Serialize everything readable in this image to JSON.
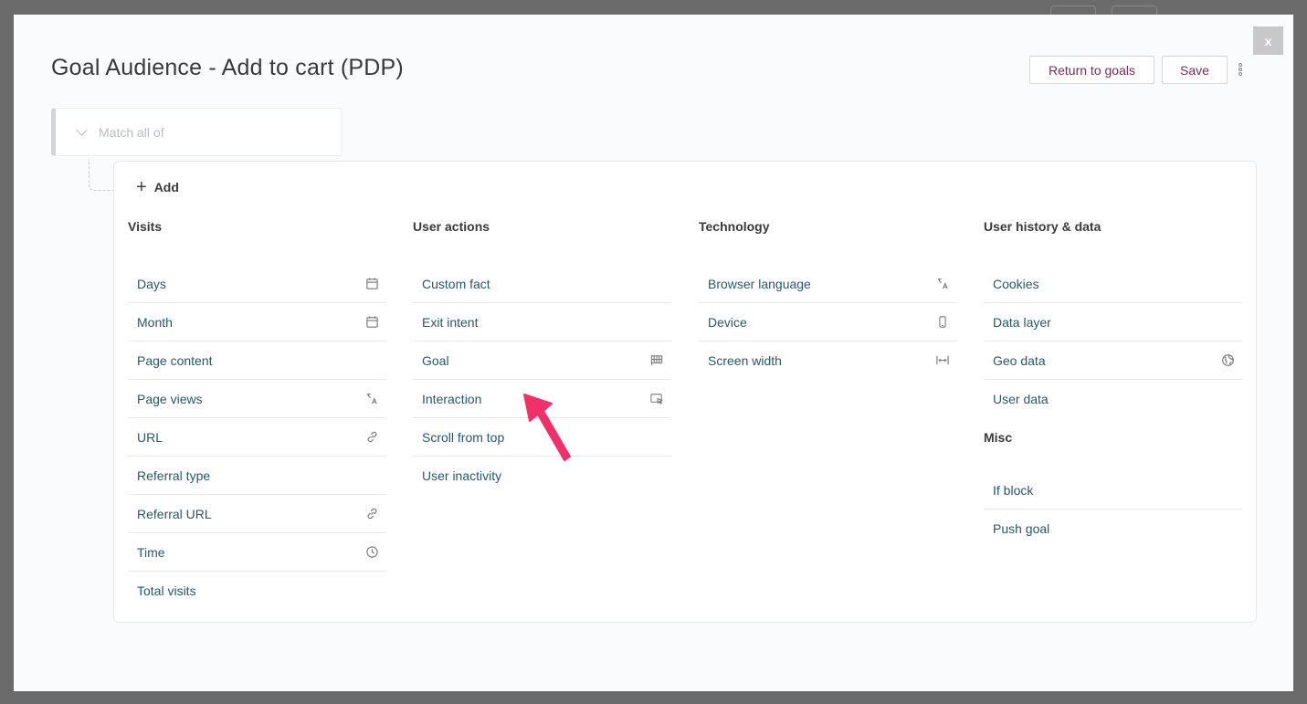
{
  "modal": {
    "title": "Goal Audience - Add to cart (PDP)",
    "close_label": "x",
    "return_label": "Return to goals",
    "save_label": "Save",
    "match_label": "Match all of",
    "add_label": "Add"
  },
  "columns": [
    {
      "title": "Visits",
      "items": [
        {
          "label": "Days",
          "icon": "calendar-icon"
        },
        {
          "label": "Month",
          "icon": "calendar-icon"
        },
        {
          "label": "Page content",
          "icon": ""
        },
        {
          "label": "Page views",
          "icon": "translate-icon"
        },
        {
          "label": "URL",
          "icon": "link-icon"
        },
        {
          "label": "Referral type",
          "icon": ""
        },
        {
          "label": "Referral URL",
          "icon": "link-icon"
        },
        {
          "label": "Time",
          "icon": "clock-icon"
        },
        {
          "label": "Total visits",
          "icon": ""
        }
      ]
    },
    {
      "title": "User actions",
      "items": [
        {
          "label": "Custom fact",
          "icon": ""
        },
        {
          "label": "Exit intent",
          "icon": ""
        },
        {
          "label": "Goal",
          "icon": "flag-icon"
        },
        {
          "label": "Interaction",
          "icon": "cursor-window-icon"
        },
        {
          "label": "Scroll from top",
          "icon": ""
        },
        {
          "label": "User inactivity",
          "icon": ""
        }
      ]
    },
    {
      "title": "Technology",
      "items": [
        {
          "label": "Browser language",
          "icon": "translate-icon"
        },
        {
          "label": "Device",
          "icon": "mobile-icon"
        },
        {
          "label": "Screen width",
          "icon": "width-icon"
        }
      ]
    },
    {
      "title": "User history & data",
      "items": [
        {
          "label": "Cookies",
          "icon": ""
        },
        {
          "label": "Data layer",
          "icon": ""
        },
        {
          "label": "Geo data",
          "icon": "globe-icon"
        },
        {
          "label": "User data",
          "icon": ""
        }
      ]
    }
  ],
  "misc": {
    "title": "Misc",
    "items": [
      {
        "label": "If block",
        "icon": ""
      },
      {
        "label": "Push goal",
        "icon": ""
      }
    ]
  },
  "colors": {
    "accent": "#8a2452",
    "item_text": "#24596e",
    "arrow": "#f0306a"
  }
}
